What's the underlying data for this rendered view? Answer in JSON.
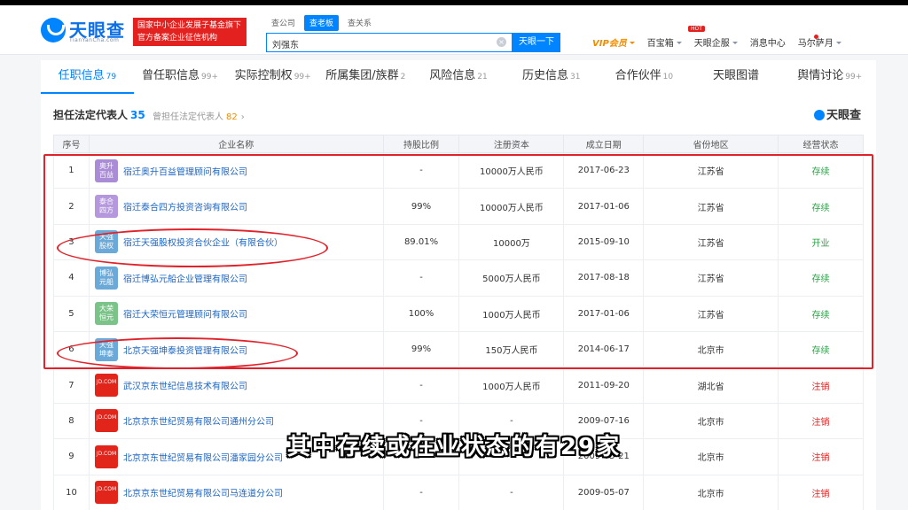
{
  "header": {
    "logo_text": "天眼查",
    "logo_sub": "TianYanCha.com",
    "gov_badge": [
      "国家中小企业发展子基金旗下",
      "官方备案企业征信机构"
    ],
    "top_tabs": [
      "查公司",
      "查老板",
      "查关系"
    ],
    "active_top_tab": "查老板",
    "search_value": "刘强东",
    "search_button": "天眼一下",
    "nav": [
      {
        "label": "VIP会员",
        "style": "vip"
      },
      {
        "label": "百宝箱",
        "badge": "HOT"
      },
      {
        "label": "天眼企服"
      },
      {
        "label": "消息中心"
      },
      {
        "label": "马尔萨月"
      }
    ]
  },
  "tabs": [
    {
      "label": "任职信息",
      "count": "79",
      "active": true
    },
    {
      "label": "曾任职信息",
      "count": "99+"
    },
    {
      "label": "实际控制权",
      "count": "99+"
    },
    {
      "label": "所属集团/族群",
      "count": "2"
    },
    {
      "label": "风险信息",
      "count": "21"
    },
    {
      "label": "历史信息",
      "count": "31"
    },
    {
      "label": "合作伙伴",
      "count": "10"
    },
    {
      "label": "天眼图谱",
      "count": ""
    },
    {
      "label": "舆情讨论",
      "count": "99+"
    }
  ],
  "section": {
    "title": "担任法定代表人",
    "count": "35",
    "alt_label": "曾担任法定代表人",
    "alt_count": "82",
    "brand": "天眼查"
  },
  "table": {
    "headers": [
      "序号",
      "企业名称",
      "持股比例",
      "注册资本",
      "成立日期",
      "省份地区",
      "经营状态"
    ],
    "rows": [
      {
        "no": "1",
        "logo": "奥升百益",
        "logo_color": "#a98bd6",
        "name": "宿迁奥升百益管理顾问有限公司",
        "share": "-",
        "capital": "10000万人民币",
        "date": "2017-06-23",
        "region": "江苏省",
        "status": "存续",
        "status_color": "#2aa146"
      },
      {
        "no": "2",
        "logo": "泰合四方",
        "logo_color": "#b597dd",
        "name": "宿迁泰合四方投资咨询有限公司",
        "share": "99%",
        "capital": "10000万人民币",
        "date": "2017-01-06",
        "region": "江苏省",
        "status": "存续",
        "status_color": "#2aa146"
      },
      {
        "no": "3",
        "logo": "天强股权",
        "logo_color": "#6aa9d8",
        "name": "宿迁天强股权投资合伙企业（有限合伙）",
        "share": "89.01%",
        "capital": "10000万",
        "date": "2015-09-10",
        "region": "江苏省",
        "status": "开业",
        "status_color": "#2aa146"
      },
      {
        "no": "4",
        "logo": "博弘元船",
        "logo_color": "#6aa9d8",
        "name": "宿迁博弘元船企业管理有限公司",
        "share": "-",
        "capital": "5000万人民币",
        "date": "2017-08-18",
        "region": "江苏省",
        "status": "存续",
        "status_color": "#2aa146"
      },
      {
        "no": "5",
        "logo": "大荣恒元",
        "logo_color": "#7cc38a",
        "name": "宿迁大荣恒元管理顾问有限公司",
        "share": "100%",
        "capital": "1000万人民币",
        "date": "2017-01-06",
        "region": "江苏省",
        "status": "存续",
        "status_color": "#2aa146"
      },
      {
        "no": "6",
        "logo": "天强坤泰",
        "logo_color": "#6aa9d8",
        "name": "北京天强坤泰投资管理有限公司",
        "share": "99%",
        "capital": "150万人民币",
        "date": "2014-06-17",
        "region": "北京市",
        "status": "存续",
        "status_color": "#2aa146"
      },
      {
        "no": "7",
        "logo": "JD.COM",
        "logo_color": "#e1251b",
        "name": "武汉京东世纪信息技术有限公司",
        "share": "-",
        "capital": "1000万人民币",
        "date": "2011-09-20",
        "region": "湖北省",
        "status": "注销",
        "status_color": "#e3211f"
      },
      {
        "no": "8",
        "logo": "JD.COM",
        "logo_color": "#e1251b",
        "name": "北京京东世纪贸易有限公司通州分公司",
        "share": "-",
        "capital": "-",
        "date": "2009-07-16",
        "region": "北京市",
        "status": "注销",
        "status_color": "#e3211f"
      },
      {
        "no": "9",
        "logo": "JD.COM",
        "logo_color": "#e1251b",
        "name": "北京京东世纪贸易有限公司潘家园分公司",
        "share": "-",
        "capital": "-",
        "date": "2009-05-21",
        "region": "北京市",
        "status": "注销",
        "status_color": "#e3211f"
      },
      {
        "no": "10",
        "logo": "JD.COM",
        "logo_color": "#e1251b",
        "name": "北京京东世纪贸易有限公司马连道分公司",
        "share": "-",
        "capital": "-",
        "date": "2009-05-07",
        "region": "北京市",
        "status": "注销",
        "status_color": "#e3211f"
      }
    ]
  },
  "subtitle": "其中存续或在业状态的有29家"
}
